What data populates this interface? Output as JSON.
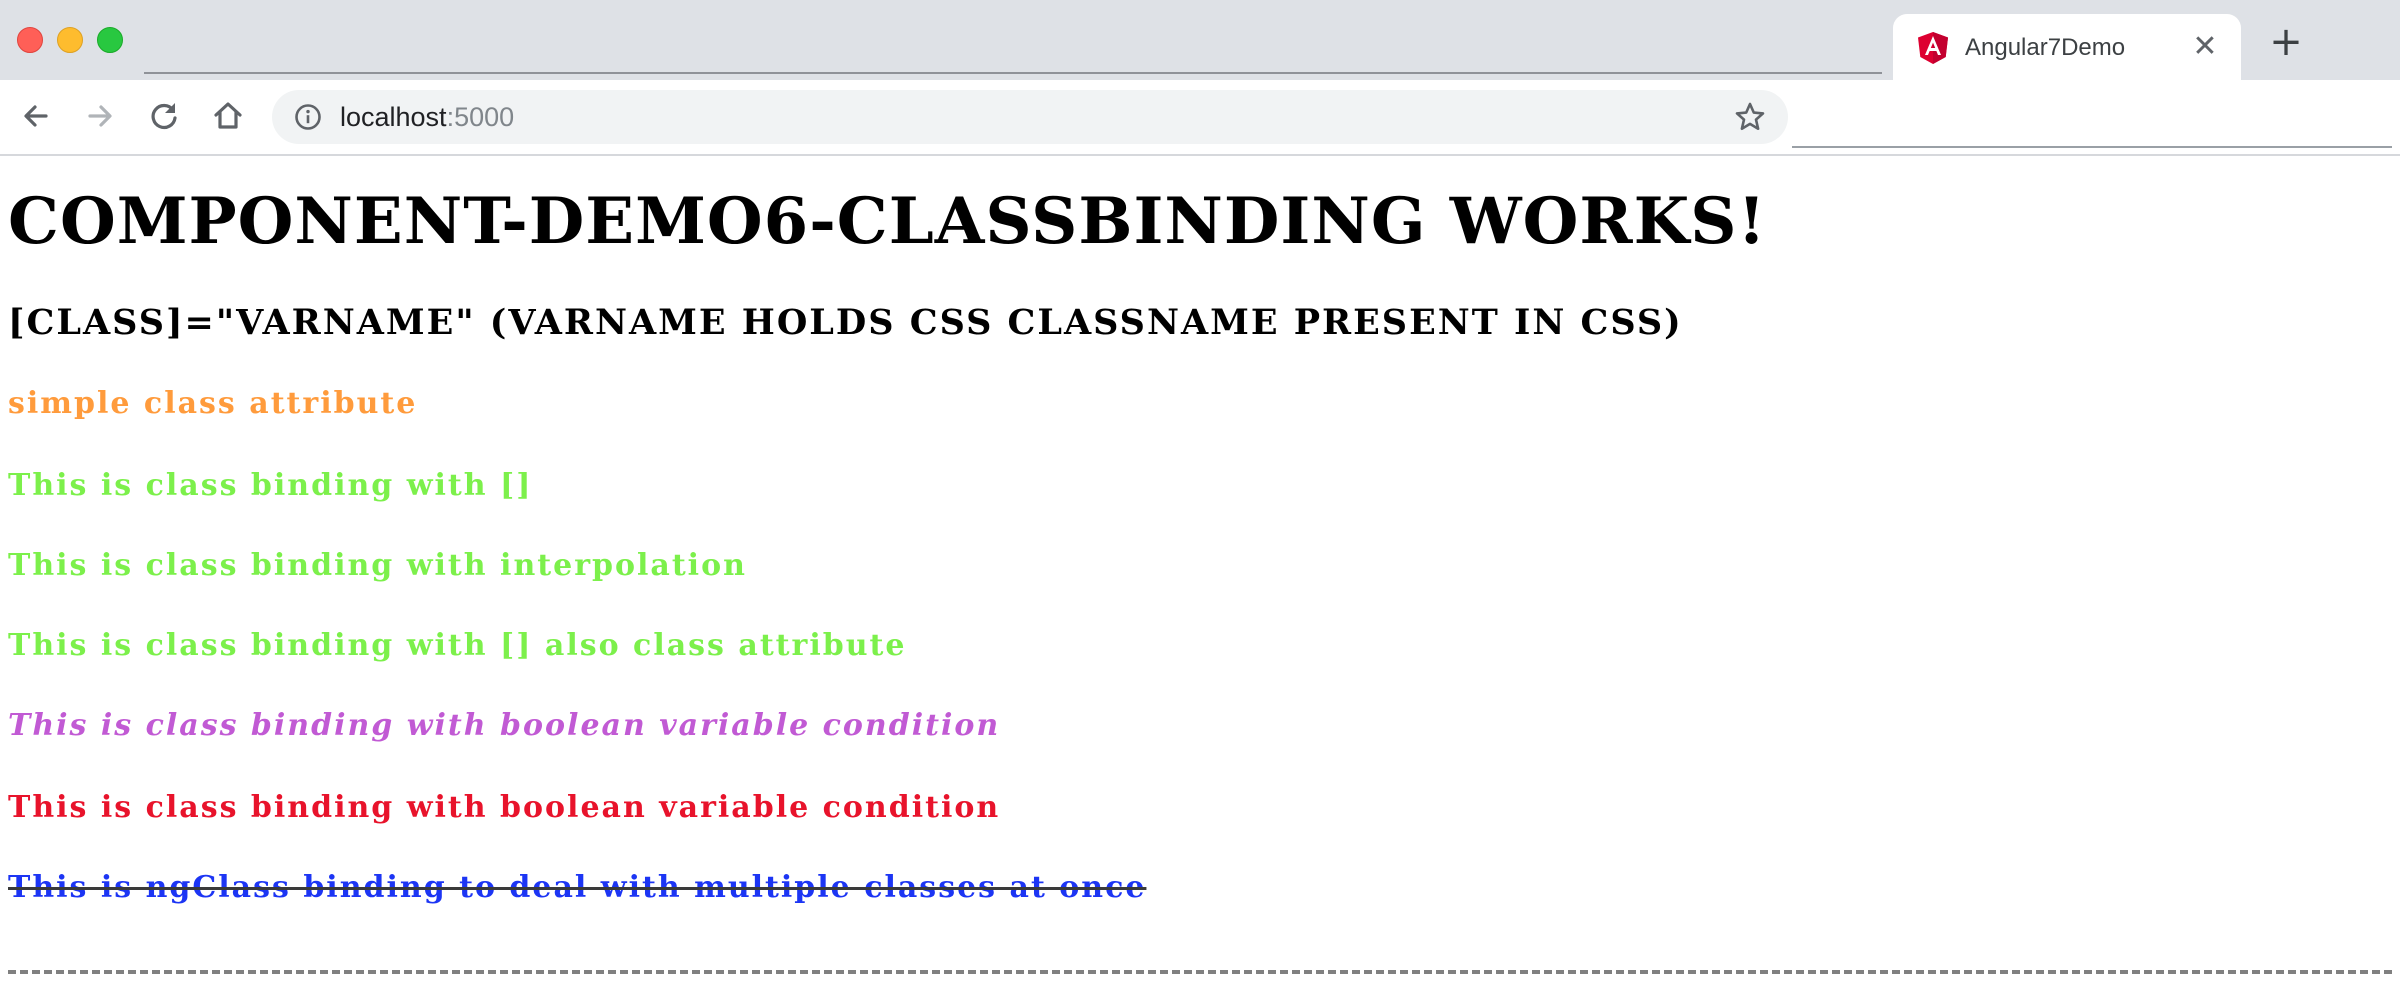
{
  "browser": {
    "tab": {
      "title": "Angular7Demo",
      "close_glyph": "✕",
      "favicon": "angular-icon"
    },
    "new_tab_glyph": "+",
    "address": {
      "host": "localhost",
      "port": ":5000"
    },
    "icons": {
      "back": "back-arrow-icon",
      "forward": "forward-arrow-icon",
      "reload": "reload-icon",
      "home": "home-icon",
      "info": "info-icon",
      "bookmark": "star-icon"
    }
  },
  "page": {
    "heading": "component-demo6-classbinding works!",
    "subheading": "[class]=\"varName\" (varName holds css classname present in css)",
    "lines": [
      {
        "text": "simple class attribute",
        "color": "#ff9b3c"
      },
      {
        "text": "This is class binding with []",
        "color": "#7cf04b"
      },
      {
        "text": "This is class binding with interpolation",
        "color": "#7cf04b"
      },
      {
        "text": "This is class binding with [] also class attribute",
        "color": "#7cf04b"
      },
      {
        "text": "This is class binding with boolean variable condition",
        "color": "#c15ad4"
      },
      {
        "text": "This is class binding with boolean variable condition",
        "color": "#e8132b"
      },
      {
        "text": "This is ngClass binding to deal with multiple classes at once",
        "color": "#1c35f4"
      }
    ]
  },
  "colors": {
    "tabbar_bg": "#dee1e6",
    "omnibox_bg": "#f1f3f4",
    "divider": "#808080"
  }
}
